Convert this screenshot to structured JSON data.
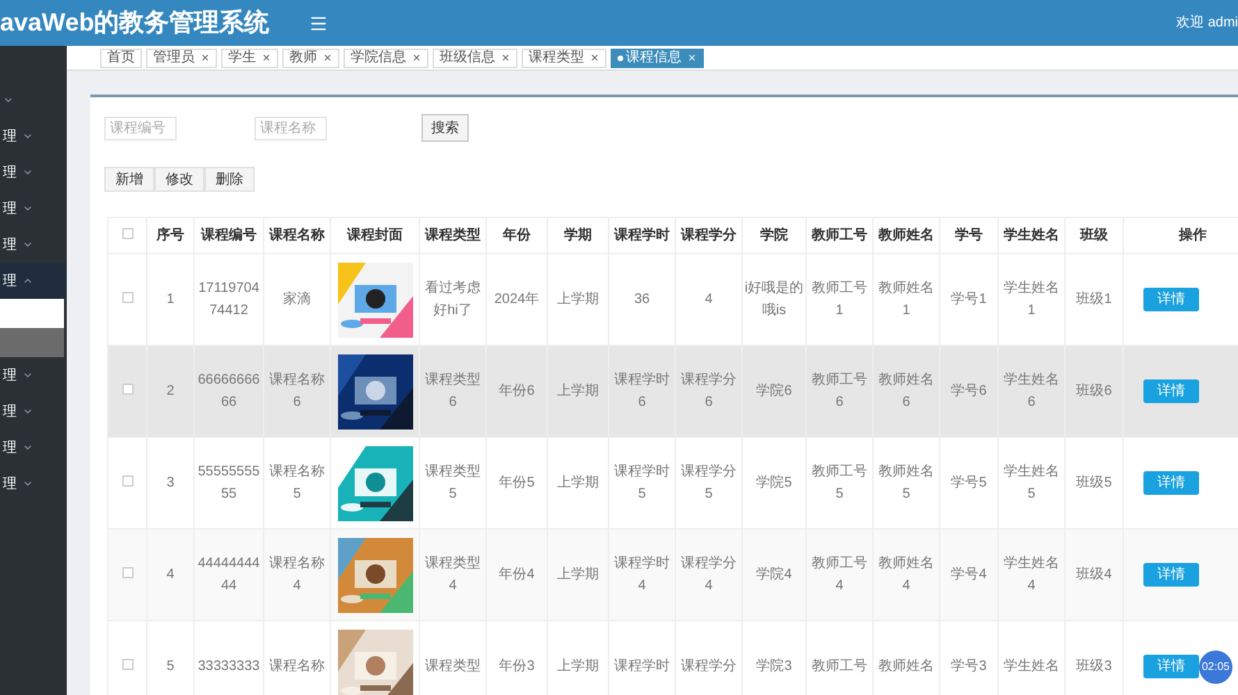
{
  "header": {
    "title": "avaWeb的教务管理系统",
    "welcome": "欢迎 admi"
  },
  "sidebar": {
    "items": [
      {
        "expanded": false
      },
      {
        "label": "理",
        "expanded": false
      },
      {
        "label": "理",
        "expanded": false
      },
      {
        "label": "理",
        "expanded": false
      },
      {
        "label": "理",
        "expanded": false
      },
      {
        "label": "理",
        "expanded": true,
        "children": [
          {
            "selected": true
          },
          {
            "selected": false
          }
        ]
      },
      {
        "label": "理",
        "expanded": false
      },
      {
        "label": "理",
        "expanded": false
      },
      {
        "label": "理",
        "expanded": false
      },
      {
        "label": "理",
        "expanded": false
      }
    ]
  },
  "tabs": [
    {
      "label": "首页",
      "closable": false,
      "selected": false
    },
    {
      "label": "管理员",
      "closable": true,
      "selected": false
    },
    {
      "label": "学生",
      "closable": true,
      "selected": false
    },
    {
      "label": "教师",
      "closable": true,
      "selected": false
    },
    {
      "label": "学院信息",
      "closable": true,
      "selected": false
    },
    {
      "label": "班级信息",
      "closable": true,
      "selected": false
    },
    {
      "label": "课程类型",
      "closable": true,
      "selected": false
    },
    {
      "label": "课程信息",
      "closable": true,
      "selected": true
    }
  ],
  "search": {
    "fields": [
      {
        "placeholder": "课程编号"
      },
      {
        "placeholder": "课程名称"
      }
    ],
    "button": "搜索"
  },
  "actions": [
    "新增",
    "修改",
    "删除"
  ],
  "table": {
    "select_all_checked": false,
    "columns": [
      "序号",
      "课程编号",
      "课程名称",
      "课程封面",
      "课程类型",
      "年份",
      "学期",
      "课程学时",
      "课程学分",
      "学院",
      "教师工号",
      "教师姓名",
      "学号",
      "学生姓名",
      "班级",
      "操作"
    ],
    "rows": [
      {
        "checked": false,
        "highlighted": false,
        "cells": [
          "1",
          "1711970474412",
          "家滴",
          {
            "kind": "picture"
          },
          "看过考虑好hi了",
          "2024年",
          "上学期",
          "36",
          "4",
          "i好哦是的哦is",
          "教师工号1",
          "教师姓名1",
          "学号1",
          "学生姓名1",
          "班级1"
        ],
        "action": "详情"
      },
      {
        "checked": false,
        "highlighted": true,
        "cells": [
          "2",
          "6666666666",
          "课程名称6",
          {
            "kind": "picture"
          },
          "课程类型6",
          "年份6",
          "上学期",
          "课程学时6",
          "课程学分6",
          "学院6",
          "教师工号6",
          "教师姓名6",
          "学号6",
          "学生姓名6",
          "班级6"
        ],
        "action": "详情"
      },
      {
        "checked": false,
        "highlighted": false,
        "cells": [
          "3",
          "5555555555",
          "课程名称5",
          {
            "kind": "picture"
          },
          "课程类型5",
          "年份5",
          "上学期",
          "课程学时5",
          "课程学分5",
          "学院5",
          "教师工号5",
          "教师姓名5",
          "学号5",
          "学生姓名5",
          "班级5"
        ],
        "action": "详情"
      },
      {
        "checked": false,
        "highlighted": false,
        "cells": [
          "4",
          "4444444444",
          "课程名称4",
          {
            "kind": "picture"
          },
          "课程类型4",
          "年份4",
          "上学期",
          "课程学时4",
          "课程学分4",
          "学院4",
          "教师工号4",
          "教师姓名4",
          "学号4",
          "学生姓名4",
          "班级4"
        ],
        "action": "详情"
      },
      {
        "checked": false,
        "highlighted": false,
        "cells": [
          "5",
          "33333333",
          "课程名称",
          {
            "kind": "picture"
          },
          "课程类型",
          "年份3",
          "上学期",
          "课程学时",
          "课程学分",
          "学院3",
          "教师工号",
          "教师姓名",
          "学号3",
          "学生姓名",
          "班级3"
        ],
        "action": "详情"
      }
    ]
  },
  "timer": "02:05"
}
